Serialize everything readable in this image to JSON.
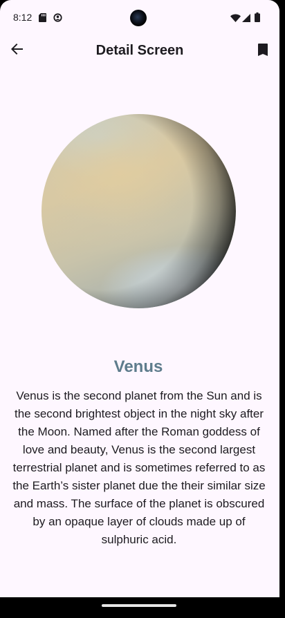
{
  "status_bar": {
    "time": "8:12",
    "icons": [
      "sd-card-icon",
      "circle-status-icon",
      "wifi-icon",
      "signal-icon",
      "battery-icon"
    ]
  },
  "app_bar": {
    "title": "Detail Screen",
    "back_icon": "arrow-back-icon",
    "bookmark_icon": "bookmark-icon"
  },
  "planet": {
    "name": "Venus",
    "description": "Venus is the second planet from the Sun and is the second brightest object in the night sky after the Moon. Named after the Roman goddess of love and beauty, Venus is the second largest terrestrial planet and is sometimes referred to as the Earth’s sister planet due the their similar size and mass. The surface of the planet is obscured by an opaque layer of clouds made up of sulphuric acid."
  },
  "colors": {
    "background": "#FEF7FF",
    "title_text": "#1d1b20",
    "planet_name": "#5e7c8c"
  }
}
